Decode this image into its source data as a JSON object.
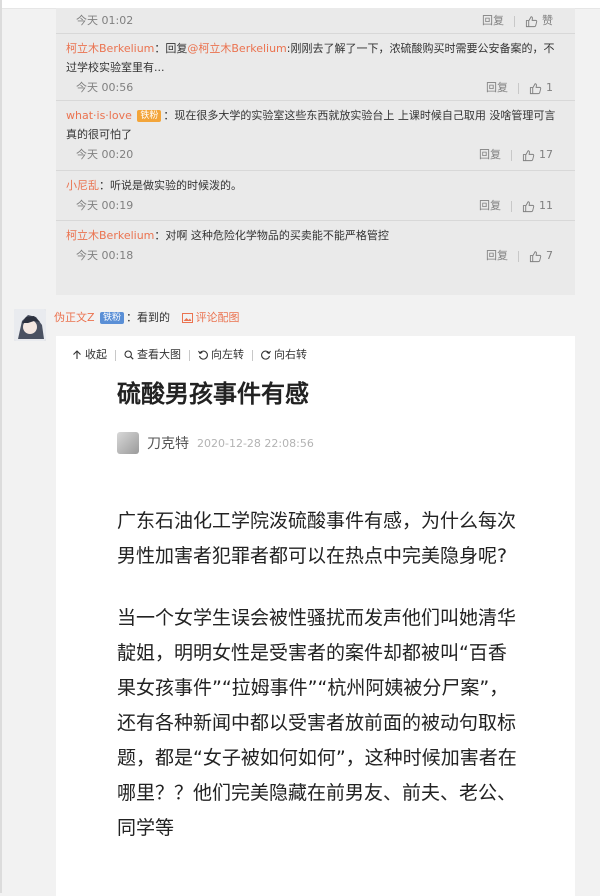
{
  "replies": [
    {
      "user": "",
      "text": "",
      "time": "今天 01:02",
      "reply_label": "回复",
      "like_label": "赞"
    },
    {
      "user": "柯立木Berkelium",
      "text_prefix": "：回复",
      "mention": "@柯立木Berkelium",
      "text": ":刚刚去了解了一下，浓硫酸购买时需要公安备案的，不过学校实验室里有...",
      "time": "今天 00:56",
      "reply_label": "回复",
      "likes": "1"
    },
    {
      "user": "what·is·love",
      "badge": "铁粉",
      "text": "：现在很多大学的实验室这些东西就放实验台上 上课时候自己取用 没啥管理可言 真的很可怕了",
      "time": "今天 00:20",
      "reply_label": "回复",
      "likes": "17"
    },
    {
      "user": "小尼乱",
      "text": "：听说是做实验的时候泼的。",
      "time": "今天 00:19",
      "reply_label": "回复",
      "likes": "11"
    },
    {
      "user": "柯立木Berkelium",
      "text": "：对啊 这种危险化学物品的买卖能不能严格管控",
      "time": "今天 00:18",
      "reply_label": "回复",
      "likes": "7"
    }
  ],
  "comment": {
    "user": "伪正文Z",
    "badge": "铁粉",
    "text": "：看到的",
    "pic_link": "评论配图"
  },
  "image_toolbar": {
    "collapse": "收起",
    "view_large": "查看大图",
    "rotate_left": "向左转",
    "rotate_right": "向右转"
  },
  "article": {
    "title": "硫酸男孩事件有感",
    "author": "刀克特",
    "date": "2020-12-28 22:08:56",
    "para1": "广东石油化工学院泼硫酸事件有感，为什么每次男性加害者犯罪者都可以在热点中完美隐身呢?",
    "para2": "当一个女学生误会被性骚扰而发声他们叫她清华靛姐，明明女性是受害者的案件却都被叫“百香果女孩事件”“拉姆事件”“杭州阿姨被分尸案”，还有各种新闻中都以受害者放前面的被动句取标题，都是“女子被如何如何”，这种时候加害者在哪里？？他们完美隐藏在前男友、前夫、老公、同学等"
  },
  "colors": {
    "username": "#eb7350",
    "meta": "#808080",
    "reply_bg": "#eaeaea",
    "page_bg": "#f2f2f2"
  }
}
